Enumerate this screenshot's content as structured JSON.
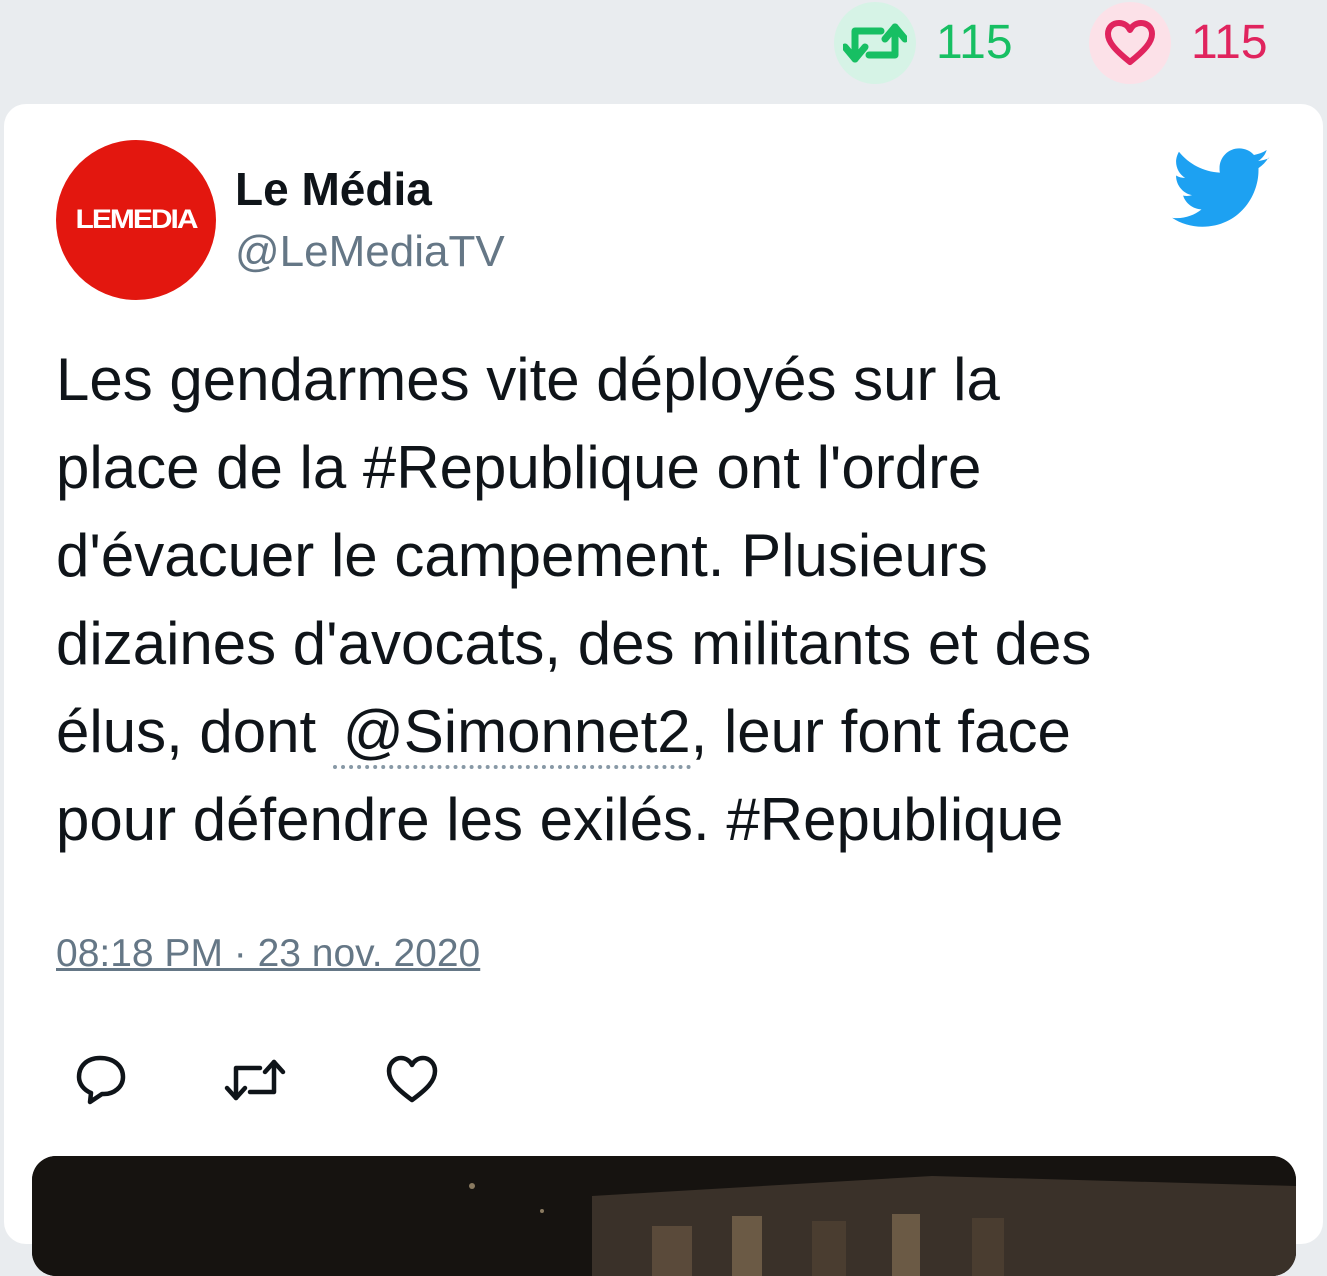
{
  "stats": {
    "retweets": "115",
    "likes": "115"
  },
  "tweet": {
    "author_name": "Le Média",
    "author_handle": "@LeMediaTV",
    "avatar_text": "LEMEDIA",
    "text_before_mention": "Les gendarmes vite déployés sur la\nplace de la #Republique ont l'ordre\nd'évacuer le campement. Plusieurs\ndizaines d'avocats, des militants et des\nélus, dont",
    "mention": "@Simonnet2",
    "text_after_mention": ", leur font face\npour défendre les exilés. #Republique",
    "timestamp": "08:18 PM · 23 nov. 2020"
  },
  "icons": {
    "retweet_stat": "retweet-icon",
    "like_stat": "heart-icon",
    "brand": "twitter-bird-icon",
    "reply_action": "reply-icon",
    "retweet_action": "retweet-icon",
    "like_action": "heart-icon"
  },
  "colors": {
    "retweet_green": "#17bf63",
    "like_pink": "#e0245e",
    "twitter_blue": "#1da1f2",
    "avatar_red": "#e3170f",
    "secondary_text": "#657786"
  }
}
